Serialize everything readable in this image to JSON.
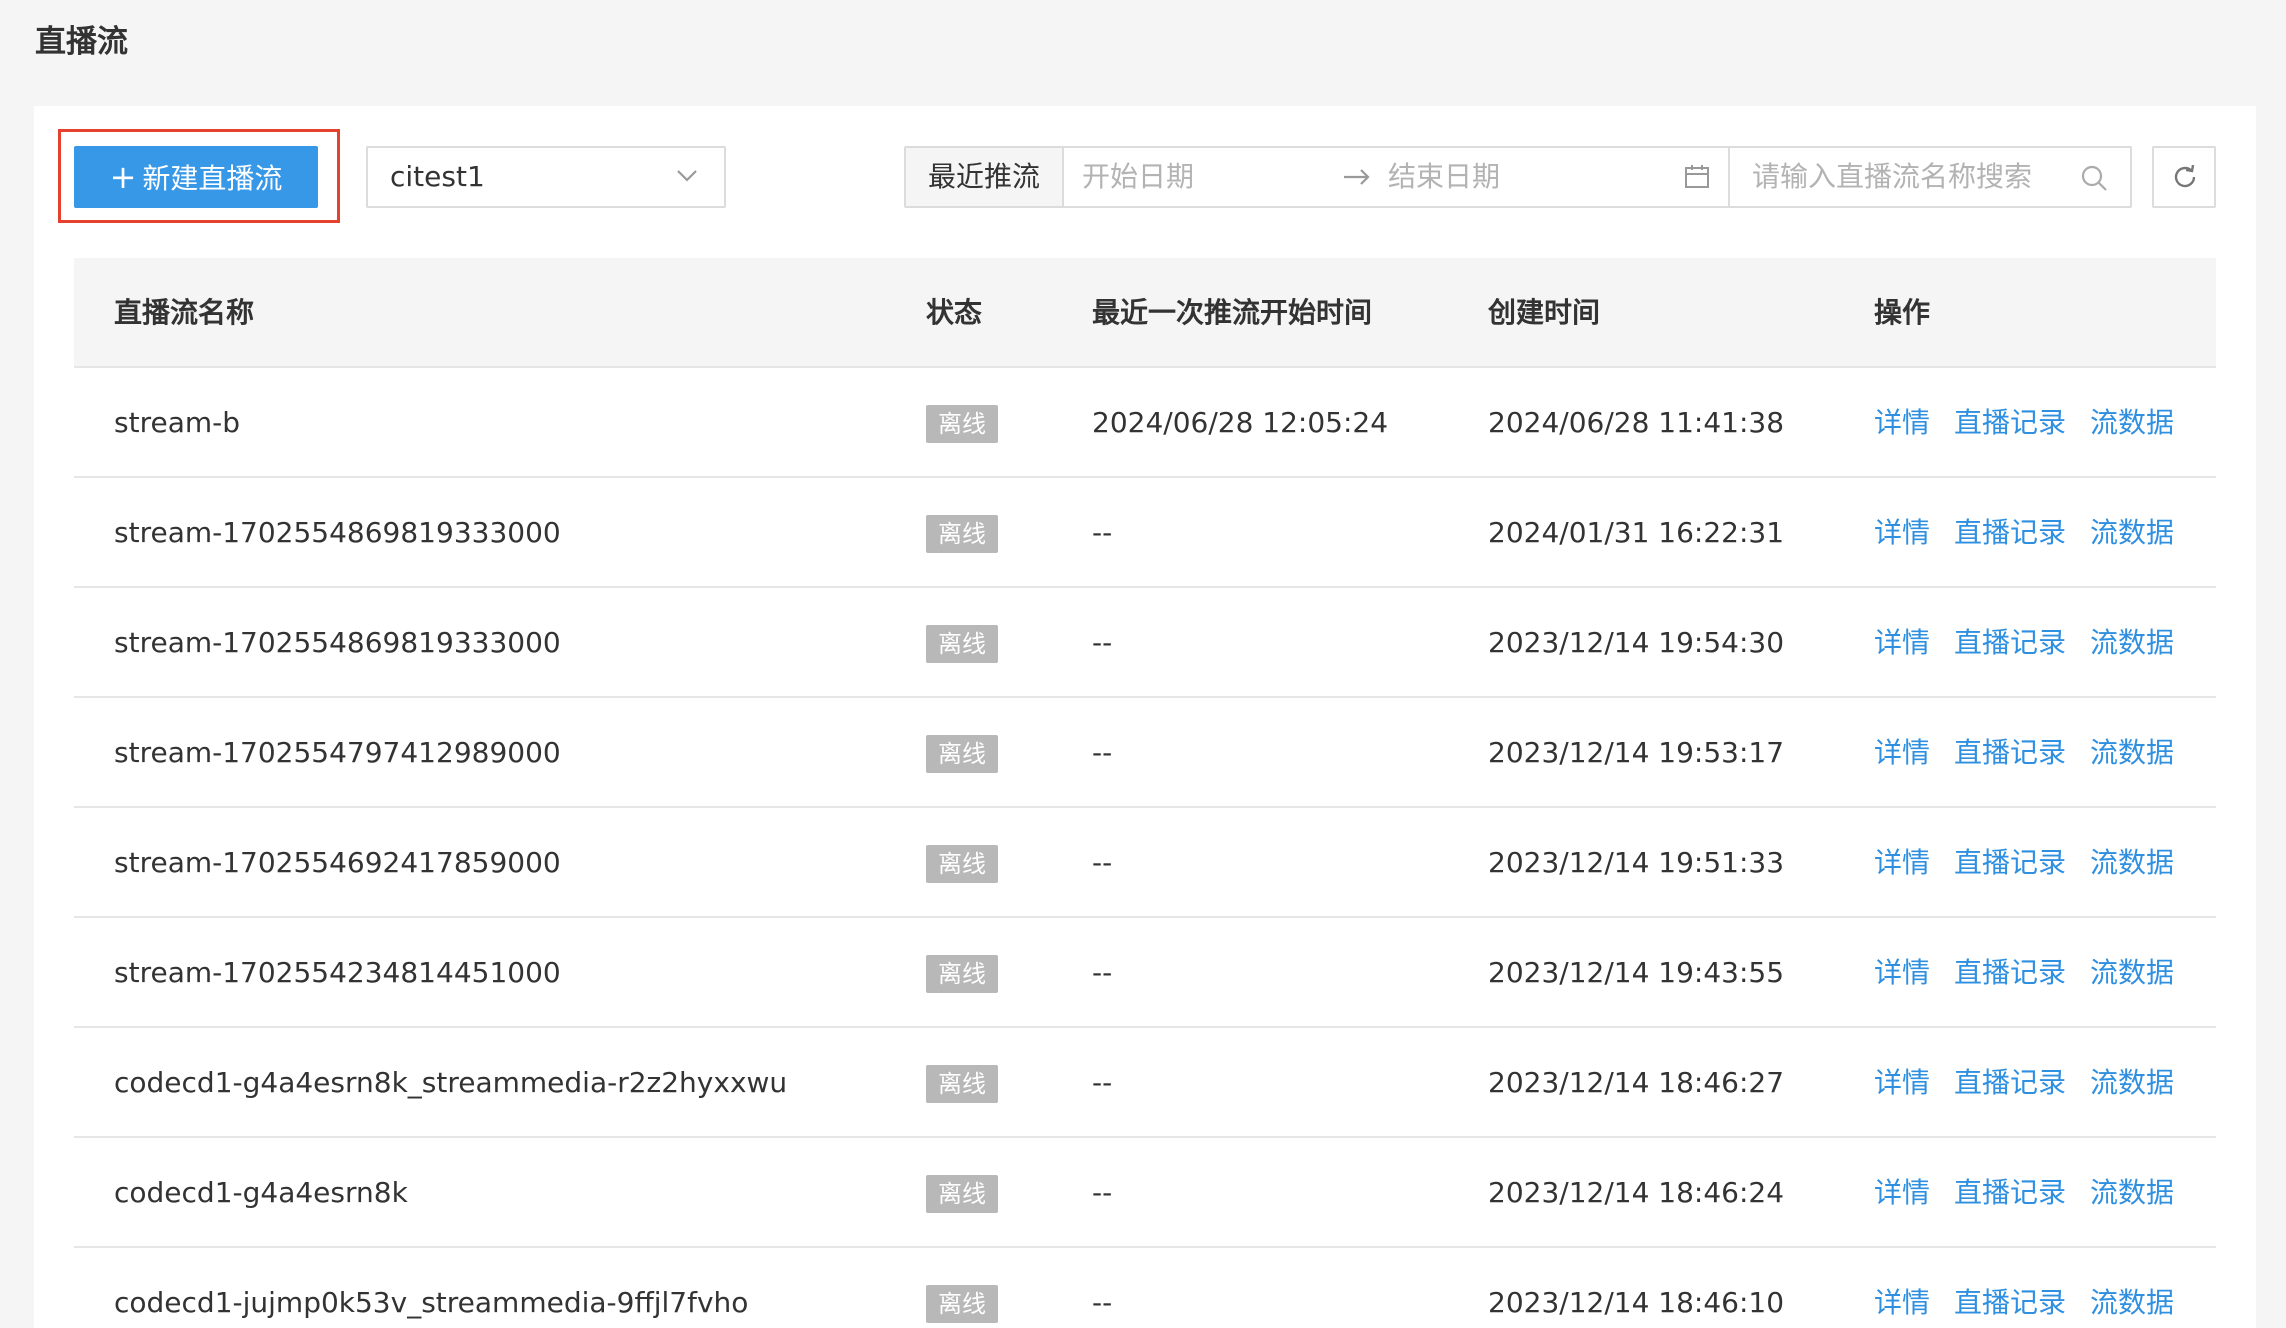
{
  "page": {
    "title": "直播流"
  },
  "toolbar": {
    "new_button_label": "新建直播流",
    "select_value": "citest1",
    "range_tag": "最近推流",
    "start_placeholder": "开始日期",
    "end_placeholder": "结束日期",
    "search_placeholder": "请输入直播流名称搜索"
  },
  "table": {
    "columns": [
      "直播流名称",
      "状态",
      "最近一次推流开始时间",
      "创建时间",
      "操作"
    ],
    "actions": [
      "详情",
      "直播记录",
      "流数据"
    ],
    "rows": [
      {
        "name": "stream-b",
        "status": "离线",
        "last_push": "2024/06/28 12:05:24",
        "created": "2024/06/28 11:41:38"
      },
      {
        "name": "stream-1702554869819333000",
        "status": "离线",
        "last_push": "--",
        "created": "2024/01/31 16:22:31"
      },
      {
        "name": "stream-1702554869819333000",
        "status": "离线",
        "last_push": "--",
        "created": "2023/12/14 19:54:30"
      },
      {
        "name": "stream-1702554797412989000",
        "status": "离线",
        "last_push": "--",
        "created": "2023/12/14 19:53:17"
      },
      {
        "name": "stream-1702554692417859000",
        "status": "离线",
        "last_push": "--",
        "created": "2023/12/14 19:51:33"
      },
      {
        "name": "stream-1702554234814451000",
        "status": "离线",
        "last_push": "--",
        "created": "2023/12/14 19:43:55"
      },
      {
        "name": "codecd1-g4a4esrn8k_streammedia-r2z2hyxxwu",
        "status": "离线",
        "last_push": "--",
        "created": "2023/12/14 18:46:27"
      },
      {
        "name": "codecd1-g4a4esrn8k",
        "status": "离线",
        "last_push": "--",
        "created": "2023/12/14 18:46:24"
      },
      {
        "name": "codecd1-jujmp0k53v_streammedia-9ffjl7fvho",
        "status": "离线",
        "last_push": "--",
        "created": "2023/12/14 18:46:10"
      }
    ]
  },
  "colors": {
    "primary": "#3898e8",
    "link": "#2f8fe0",
    "highlight": "#e5412d",
    "badge_offline": "#b8b8b8"
  }
}
